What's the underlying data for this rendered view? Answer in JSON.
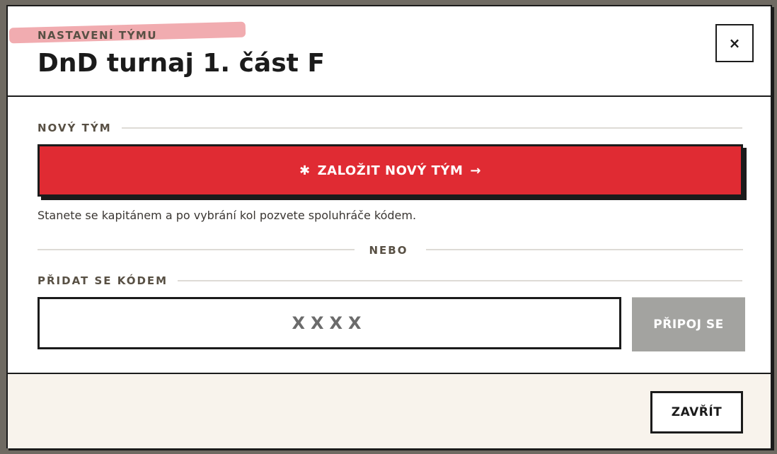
{
  "modal": {
    "eyebrow": "NASTAVENÍ TÝMU",
    "title": "DnD turnaj 1. část F",
    "close_label": "×"
  },
  "new_team": {
    "section_label": "NOVÝ TÝM",
    "button_icon": "✱",
    "button_label": "ZALOŽIT NOVÝ TÝM",
    "button_arrow": "→",
    "hint": "Stanete se kapitánem a po vybrání kol pozvete spoluhráče kódem."
  },
  "divider": {
    "label": "NEBO"
  },
  "join": {
    "section_label": "PŘIDAT SE KÓDEM",
    "code_placeholder": "XXXX",
    "join_button_label": "PŘIPOJ SE"
  },
  "footer": {
    "close_button_label": "ZAVŘÍT"
  },
  "colors": {
    "accent": "#e02b33",
    "border": "#1b1b1b",
    "muted_label": "#585044",
    "disabled_button": "#a3a3a0",
    "footer_bg": "#f8f3ec",
    "highlight": "#ef9da2"
  }
}
